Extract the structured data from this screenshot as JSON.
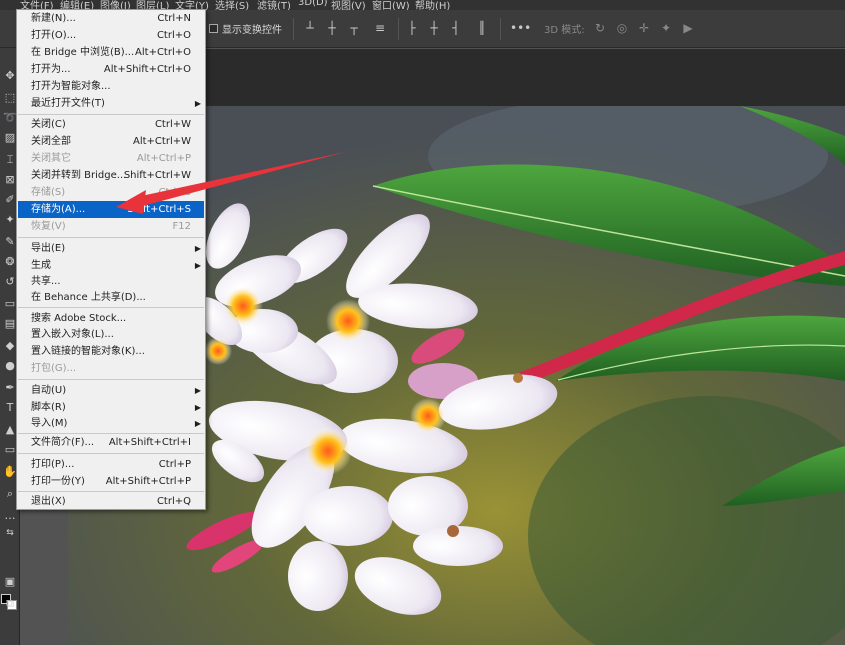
{
  "menubar": {
    "items": [
      "文件(F)",
      "编辑(E)",
      "图像(I)",
      "图层(L)",
      "文字(Y)",
      "选择(S)",
      "滤镜(T)",
      "3D(D)",
      "视图(V)",
      "窗口(W)",
      "帮助(H)"
    ]
  },
  "options_bar": {
    "show_transform_label": "显示变换控件",
    "mode_3d_label": "3D 模式:"
  },
  "file_menu": {
    "items": [
      {
        "label": "新建(N)...",
        "shortcut": "Ctrl+N"
      },
      {
        "label": "打开(O)...",
        "shortcut": "Ctrl+O"
      },
      {
        "label": "在 Bridge 中浏览(B)...",
        "shortcut": "Alt+Ctrl+O"
      },
      {
        "label": "打开为...",
        "shortcut": "Alt+Shift+Ctrl+O"
      },
      {
        "label": "打开为智能对象...",
        "shortcut": ""
      },
      {
        "label": "最近打开文件(T)",
        "shortcut": ""
      },
      {
        "label": "关闭(C)",
        "shortcut": "Ctrl+W"
      },
      {
        "label": "关闭全部",
        "shortcut": "Alt+Ctrl+W"
      },
      {
        "label": "关闭其它",
        "shortcut": "Alt+Ctrl+P"
      },
      {
        "label": "关闭并转到 Bridge...",
        "shortcut": "Shift+Ctrl+W"
      },
      {
        "label": "存储(S)",
        "shortcut": "Ctrl+S"
      },
      {
        "label": "存储为(A)...",
        "shortcut": "Shift+Ctrl+S"
      },
      {
        "label": "恢复(V)",
        "shortcut": "F12"
      },
      {
        "label": "导出(E)",
        "shortcut": ""
      },
      {
        "label": "生成",
        "shortcut": ""
      },
      {
        "label": "共享...",
        "shortcut": ""
      },
      {
        "label": "在 Behance 上共享(D)...",
        "shortcut": ""
      },
      {
        "label": "搜索 Adobe Stock...",
        "shortcut": ""
      },
      {
        "label": "置入嵌入对象(L)...",
        "shortcut": ""
      },
      {
        "label": "置入链接的智能对象(K)...",
        "shortcut": ""
      },
      {
        "label": "打包(G)...",
        "shortcut": ""
      },
      {
        "label": "自动(U)",
        "shortcut": ""
      },
      {
        "label": "脚本(R)",
        "shortcut": ""
      },
      {
        "label": "导入(M)",
        "shortcut": ""
      },
      {
        "label": "文件简介(F)...",
        "shortcut": "Alt+Shift+Ctrl+I"
      },
      {
        "label": "打印(P)...",
        "shortcut": "Ctrl+P"
      },
      {
        "label": "打印一份(Y)",
        "shortcut": "Alt+Shift+Ctrl+P"
      },
      {
        "label": "退出(X)",
        "shortcut": "Ctrl+Q"
      }
    ]
  },
  "colors": {
    "highlight": "#0a64c8",
    "arrow": "#e8333a"
  }
}
